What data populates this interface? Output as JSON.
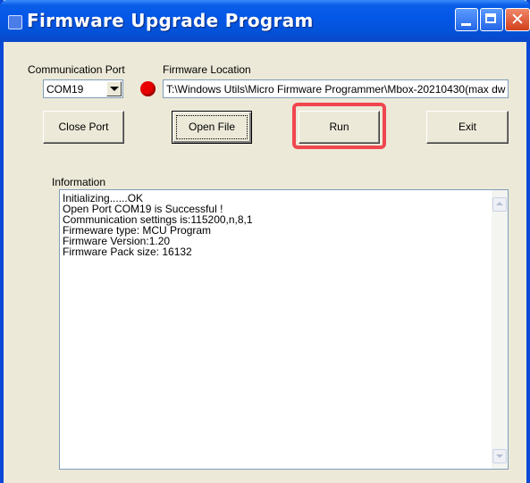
{
  "window": {
    "title": "Firmware Upgrade Program",
    "controls": {
      "minimize": "minimize",
      "maximize": "maximize",
      "close": "✕"
    }
  },
  "port": {
    "label": "Communication Port",
    "selected": "COM19",
    "status_color": "#e80000"
  },
  "firmware": {
    "label": "Firmware Location",
    "path": "T:\\Windows Utils\\Micro Firmware Programmer\\Mbox-20210430(max dw"
  },
  "buttons": {
    "close_port": "Close Port",
    "open_file": "Open File",
    "run": "Run",
    "exit": "Exit"
  },
  "information": {
    "label": "Information",
    "lines": [
      "Initializing......OK",
      "Open Port COM19 is Successful !",
      "Communication settings is:115200,n,8,1",
      "Firmeware type: MCU Program",
      "Firmware Version:1.20",
      "Firmware Pack size: 16132"
    ]
  },
  "highlight_color": "#f04650"
}
